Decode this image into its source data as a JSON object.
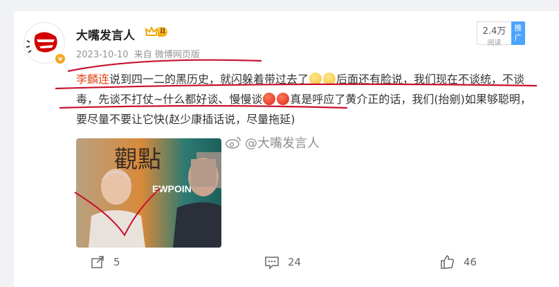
{
  "post": {
    "author": {
      "name": "大嘴发言人",
      "level": "Ⅱ",
      "verified_badge": "v"
    },
    "date": "2023-10-10",
    "source": "来自 微博网页版",
    "read_count": "2.4万",
    "read_label": "阅读",
    "promote_label": "推广",
    "text": {
      "mention": "李麟连",
      "part1": "说到四一二的黑历史，就闪躲着带过去了",
      "part2": "后面还有脸说，我们现在不谈统，不谈毒，先谈不打仗~什么都好谈、慢慢谈",
      "part3": "真是呼应了黄介正的话，我们(抬剜)如果够聪明，要尽量不要让它快(赵少康插话说，尽量拖延)"
    },
    "image": {
      "watermark": "@大嘴发言人",
      "sign_text_top": "觀點",
      "sign_text_bottom": "EWPOINT"
    },
    "actions": {
      "repost_count": "5",
      "comment_count": "24",
      "like_count": "46"
    }
  },
  "colors": {
    "mention": "#e1461a",
    "annotation_red": "#c8102e",
    "promote_blue": "#4aa4ff"
  },
  "icons": [
    "repost-icon",
    "comment-icon",
    "like-icon",
    "crown-icon",
    "weibo-logo-icon"
  ]
}
